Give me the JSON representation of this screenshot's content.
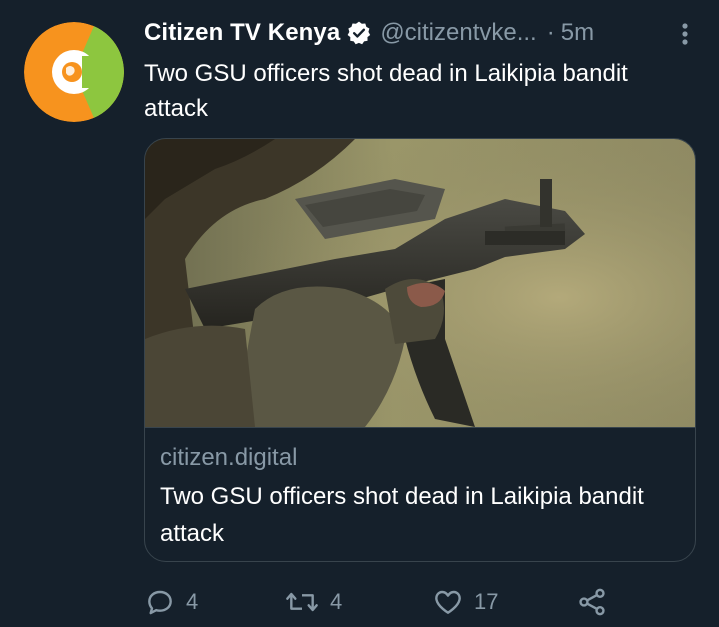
{
  "tweet": {
    "display_name": "Citizen TV Kenya",
    "handle": "@citizentvke...",
    "separator": "·",
    "time": "5m",
    "text": "Two GSU officers shot dead in Laikipia bandit attack"
  },
  "card": {
    "domain": "citizen.digital",
    "title": "Two GSU officers shot dead in Laikipia bandit attack",
    "image_icon": "rifle-photo"
  },
  "actions": {
    "replies": "4",
    "retweets": "4",
    "likes": "17"
  },
  "colors": {
    "background": "#15202b",
    "secondary_text": "#8899a6",
    "border": "#38444d",
    "avatar_orange": "#f7931e",
    "avatar_green": "#8dc63f"
  }
}
